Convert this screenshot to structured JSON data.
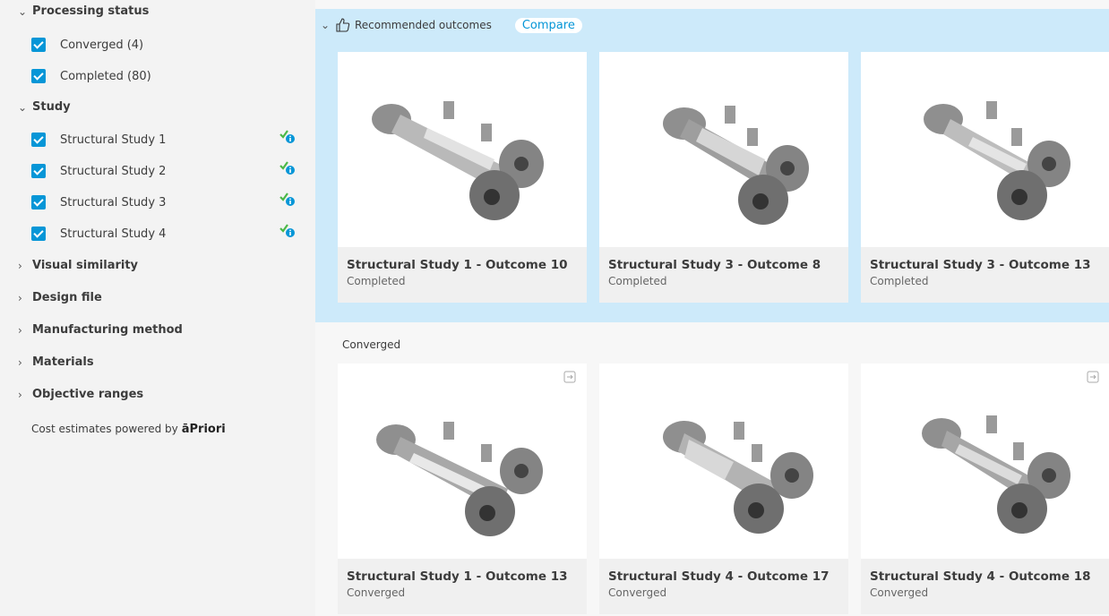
{
  "sidebar": {
    "processing_status": {
      "header": "Processing status",
      "items": [
        {
          "label": "Converged (4)"
        },
        {
          "label": "Completed (80)"
        }
      ]
    },
    "study": {
      "header": "Study",
      "items": [
        {
          "label": "Structural Study 1"
        },
        {
          "label": "Structural Study 2"
        },
        {
          "label": "Structural Study 3"
        },
        {
          "label": "Structural Study 4"
        }
      ]
    },
    "collapsed_sections": [
      {
        "label": "Visual similarity"
      },
      {
        "label": "Design file"
      },
      {
        "label": "Manufacturing method"
      },
      {
        "label": "Materials"
      },
      {
        "label": "Objective ranges"
      }
    ],
    "footer": {
      "text": "Cost estimates powered by",
      "brand": "āPriori"
    }
  },
  "recommended": {
    "title": "Recommended outcomes",
    "compare_label": "Compare",
    "cards": [
      {
        "title": "Structural Study 1 - Outcome 10",
        "status": "Completed"
      },
      {
        "title": "Structural Study 3 - Outcome 8",
        "status": "Completed"
      },
      {
        "title": "Structural Study 3 - Outcome 13",
        "status": "Completed"
      }
    ]
  },
  "converged": {
    "title": "Converged",
    "cards": [
      {
        "title": "Structural Study 1 - Outcome 13",
        "status": "Converged"
      },
      {
        "title": "Structural Study 4 - Outcome 17",
        "status": "Converged"
      },
      {
        "title": "Structural Study 4 - Outcome 18",
        "status": "Converged"
      }
    ]
  },
  "colors": {
    "accent": "#0696d7",
    "panel": "#cdeafa",
    "check_green": "#4cb848"
  }
}
